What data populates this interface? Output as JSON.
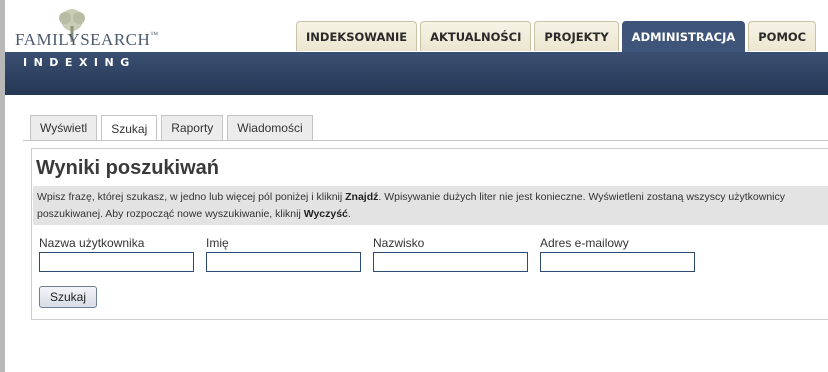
{
  "header": {
    "logo_text": "FAMILYSEARCH",
    "band_label": "INDEXING",
    "nav_tabs": [
      {
        "label": "INDEKSOWANIE",
        "active": false
      },
      {
        "label": "AKTUALNOŚCI",
        "active": false
      },
      {
        "label": "PROJEKTY",
        "active": false
      },
      {
        "label": "ADMINISTRACJA",
        "active": true
      },
      {
        "label": "POMOC",
        "active": false
      }
    ]
  },
  "subtabs": [
    {
      "label": "Wyświetl",
      "active": false
    },
    {
      "label": "Szukaj",
      "active": true
    },
    {
      "label": "Raporty",
      "active": false
    },
    {
      "label": "Wiadomości",
      "active": false
    }
  ],
  "main": {
    "title": "Wyniki poszukiwań",
    "instructions_1": "Wpisz frazę, której szukasz, w jedno lub więcej pól poniżej i kliknij ",
    "instructions_find": "Znajdź",
    "instructions_2": ". Wpisywanie dużych liter nie jest konieczne. Wyświetleni zostaną wszyscy użytkownicy ",
    "instructions_3": "poszukiwanej. Aby rozpocząć nowe wyszukiwanie, kliknij ",
    "instructions_clear": "Wyczyść",
    "instructions_4": ".",
    "fields": [
      {
        "label": "Nazwa użytkownika",
        "value": ""
      },
      {
        "label": "Imię",
        "value": ""
      },
      {
        "label": "Nazwisko",
        "value": ""
      },
      {
        "label": "Adres e-mailowy",
        "value": ""
      }
    ],
    "search_button": "Szukaj"
  },
  "colors": {
    "header_band": "#2f4265",
    "active_tab": "#3e5478",
    "tab_bg": "#f2eedb",
    "input_border": "#2d4a72"
  },
  "icons": {
    "logo": "family-tree-icon"
  }
}
